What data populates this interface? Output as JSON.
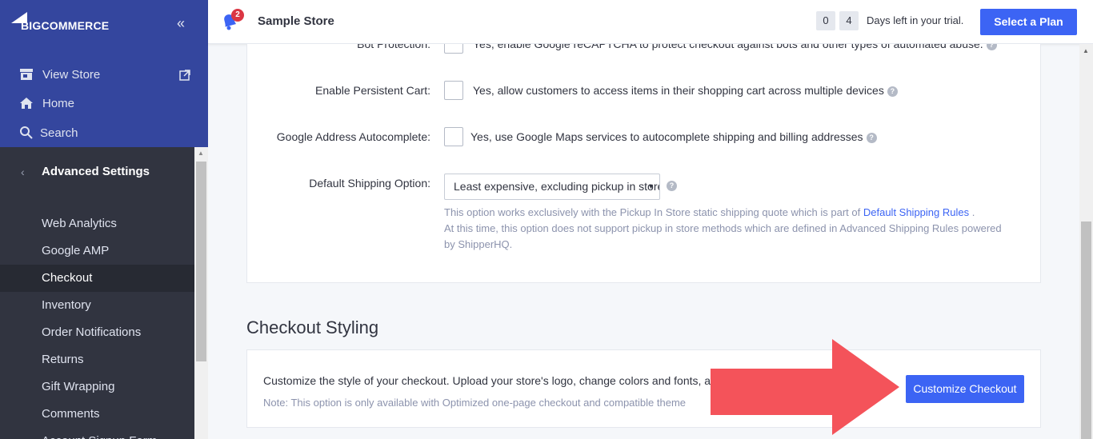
{
  "sidebar": {
    "brand": "BIGCOMMERCE",
    "collapse": "«",
    "links": {
      "view_store": "View Store",
      "home": "Home",
      "search": "Search"
    },
    "section": "Advanced Settings",
    "back": "‹",
    "items": [
      "Web Analytics",
      "Google AMP",
      "Checkout",
      "Inventory",
      "Order Notifications",
      "Returns",
      "Gift Wrapping",
      "Comments",
      "Account Signup Form"
    ],
    "active_item": "Checkout"
  },
  "header": {
    "notifications_count": "2",
    "store_name": "Sample Store",
    "trial_days": [
      "0",
      "4"
    ],
    "trial_text": "Days left in your trial.",
    "plan_button": "Select a Plan"
  },
  "checkout_settings": {
    "bot_protection_label": "Bot Protection:",
    "bot_protection_text": "Yes, enable Google reCAPTCHA to protect checkout against bots and other types of automated abuse.",
    "persistent_cart_label": "Enable Persistent Cart:",
    "persistent_cart_text": "Yes, allow customers to access items in their shopping cart across multiple devices",
    "address_autocomplete_label": "Google Address Autocomplete:",
    "address_autocomplete_text": "Yes, use Google Maps services to autocomplete shipping and billing addresses",
    "default_shipping_label": "Default Shipping Option:",
    "default_shipping_value": "Least expensive, excluding pickup in store",
    "note_before_link": "This option works exclusively with the Pickup In Store static shipping quote which is part of ",
    "note_link": "Default Shipping Rules",
    "note_after_link": " .",
    "note_line2": "At this time, this option does not support pickup in store methods which are defined in Advanced Shipping Rules powered by ShipperHQ."
  },
  "checkout_styling": {
    "title": "Checkout Styling",
    "description": "Customize the style of your checkout. Upload your store's logo, change colors and fonts, a",
    "note": "Note: This option is only available with Optimized one-page checkout and compatible theme",
    "button": "Customize Checkout"
  },
  "colors": {
    "sidebar_top": "#34469e",
    "sidebar_bottom": "#313440",
    "accent": "#3c64f4",
    "arrow": "#f4535a"
  }
}
